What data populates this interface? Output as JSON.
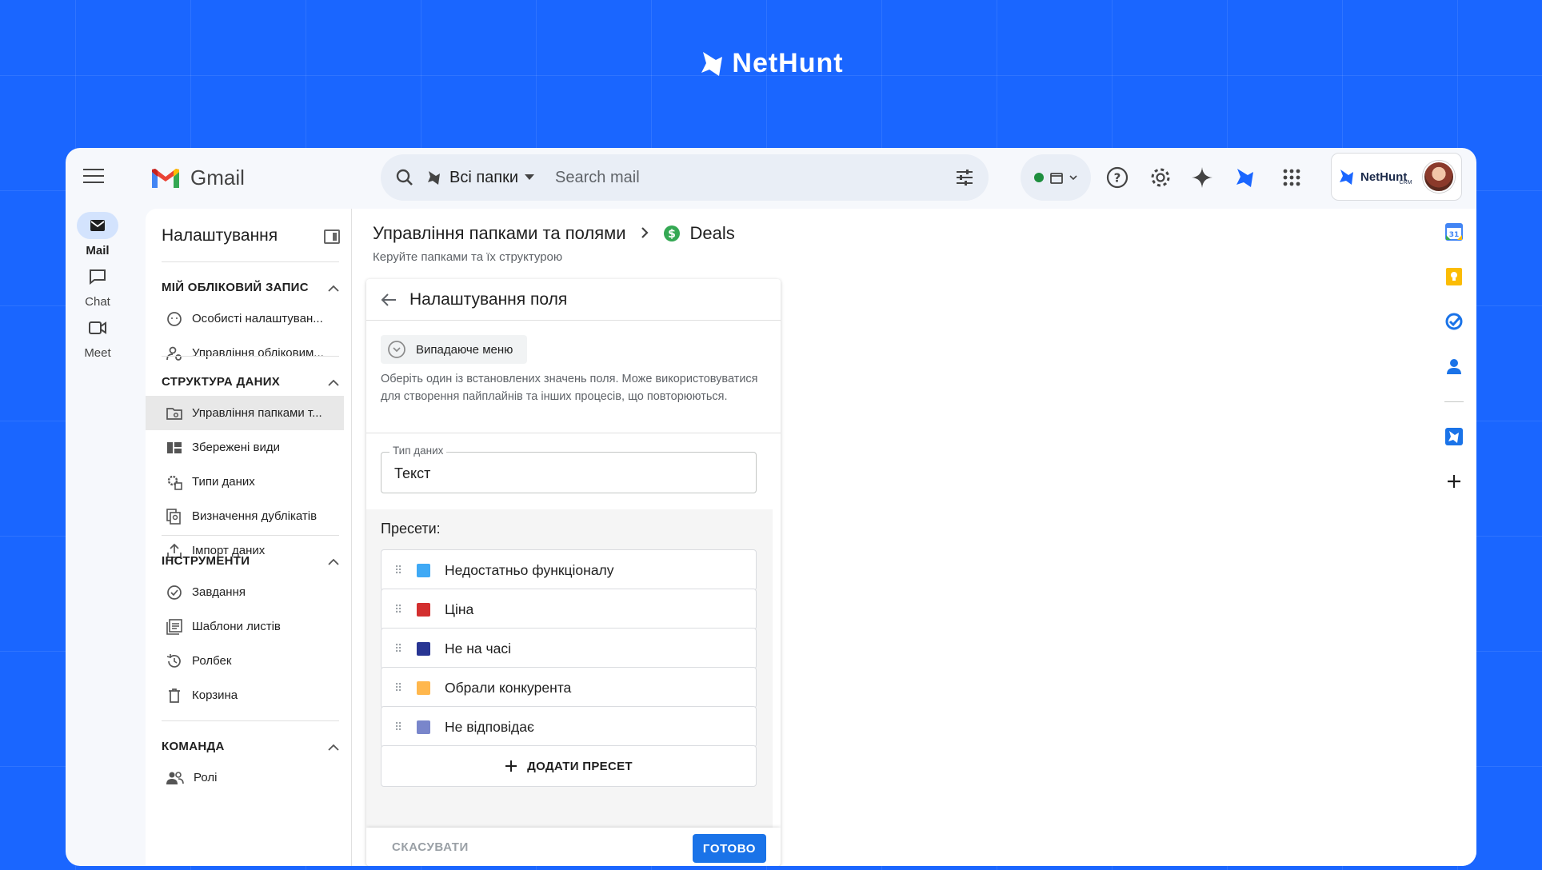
{
  "brand": {
    "name": "NetHunt"
  },
  "rail": {
    "items": [
      {
        "label": "Mail"
      },
      {
        "label": "Chat"
      },
      {
        "label": "Meet"
      }
    ]
  },
  "header": {
    "app_name": "Gmail",
    "search": {
      "folder_label": "Всі папки",
      "placeholder": "Search mail"
    },
    "account_brand": "NetHunt",
    "account_brand_sub": "CRM"
  },
  "settings": {
    "title": "Налаштування",
    "sections": [
      {
        "title": "МІЙ ОБЛІКОВИЙ ЗАПИС",
        "items": [
          "Особисті налаштуван...",
          "Управління обліковим..."
        ]
      },
      {
        "title": "СТРУКТУРА ДАНИХ",
        "items": [
          "Управління папками т...",
          "Збережені види",
          "Типи даних",
          "Визначення дублікатів",
          "Імпорт даних"
        ]
      },
      {
        "title": "ІНСТРУМЕНТИ",
        "items": [
          "Завдання",
          "Шаблони листів",
          "Ролбек",
          "Корзина"
        ]
      },
      {
        "title": "КОМАНДА",
        "items": [
          "Ролі"
        ]
      }
    ]
  },
  "main": {
    "breadcrumb": {
      "parent": "Управління папками та полями",
      "current": "Deals"
    },
    "subtitle": "Керуйте папками та їх структурою",
    "card": {
      "title": "Налаштування поля",
      "field_type_chip": "Випадаюче меню",
      "description": "Оберіть один із встановлених значень поля. Може використовуватися для створення пайплайнів та інших процесів, що повторюються.",
      "data_type": {
        "label": "Тип даних",
        "value": "Текст"
      },
      "presets_title": "Пресети:",
      "presets": [
        {
          "label": "Недостатньо функціоналу",
          "color": "#3fa9f5"
        },
        {
          "label": "Ціна",
          "color": "#d32f2f"
        },
        {
          "label": "Не на часі",
          "color": "#283593"
        },
        {
          "label": "Обрали конкурента",
          "color": "#ffb74d"
        },
        {
          "label": "Не відповідає",
          "color": "#7986cb"
        }
      ],
      "add_preset": "ДОДАТИ ПРЕСЕТ",
      "cancel": "СКАСУВАТИ",
      "done": "ГОТОВО"
    }
  },
  "colors": {
    "background": "#1a66ff",
    "accent": "#1a73e8",
    "deals_icon": "#34a853"
  }
}
